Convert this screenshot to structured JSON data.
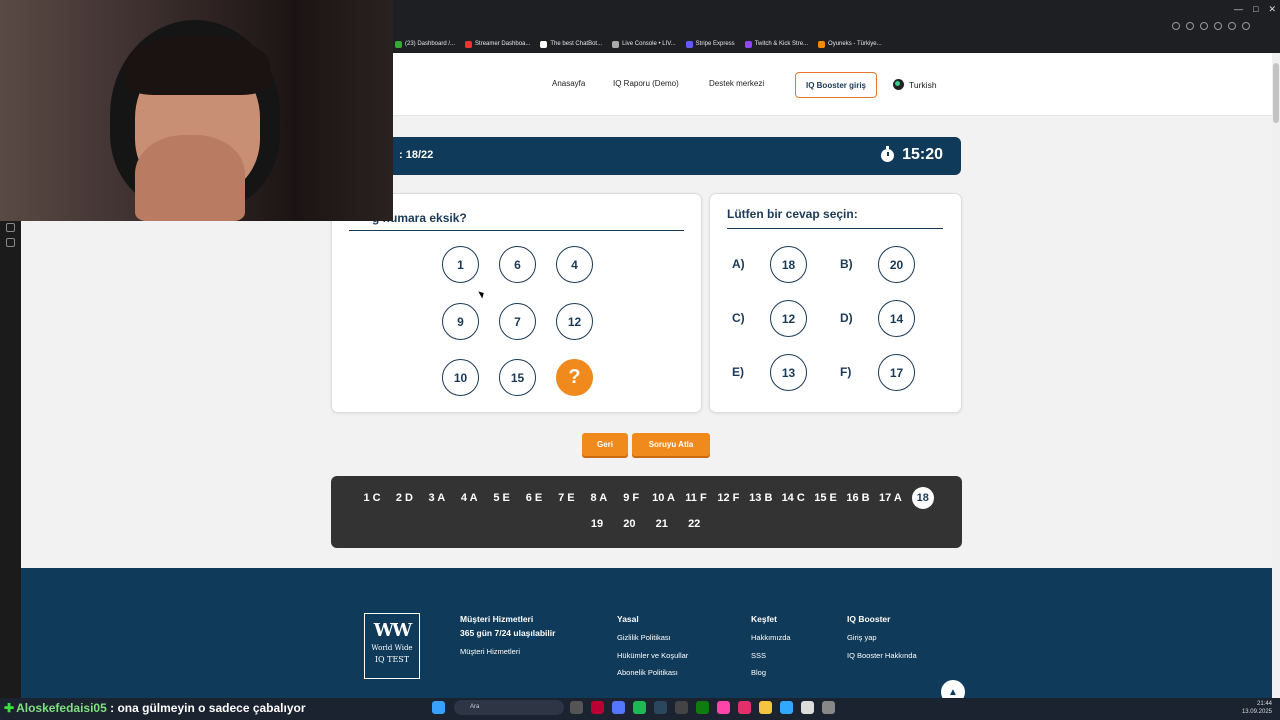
{
  "browser": {
    "bookmarks": [
      {
        "label": "(23) Dashboard /...",
        "color": "#3a3"
      },
      {
        "label": "Streamer Dashboa...",
        "color": "#e33"
      },
      {
        "label": "The best ChatBot...",
        "color": "#fff"
      },
      {
        "label": "Live Console • LIV...",
        "color": "#aaa"
      },
      {
        "label": "Stripe Express",
        "color": "#635bff"
      },
      {
        "label": "Twitch & Kick Stre...",
        "color": "#9146ff"
      },
      {
        "label": "Oyuneks - Türkiye...",
        "color": "#f80"
      }
    ]
  },
  "nav": {
    "home": "Anasayfa",
    "report": "IQ Raporu (Demo)",
    "support": "Destek merkezi",
    "booster_login": "IQ Booster giriş",
    "language": "Turkish"
  },
  "question_bar": {
    "progress": ": 18/22",
    "timer": "15:20"
  },
  "question_card": {
    "title": "g numara eksik?",
    "grid": [
      "1",
      "6",
      "4",
      "9",
      "7",
      "12",
      "10",
      "15",
      "?"
    ]
  },
  "answer_card": {
    "title": "Lütfen bir cevap seçin:",
    "options": [
      {
        "letter": "A)",
        "value": "18"
      },
      {
        "letter": "B)",
        "value": "20"
      },
      {
        "letter": "C)",
        "value": "12"
      },
      {
        "letter": "D)",
        "value": "14"
      },
      {
        "letter": "E)",
        "value": "13"
      },
      {
        "letter": "F)",
        "value": "17"
      }
    ]
  },
  "buttons": {
    "back": "Geri",
    "skip": "Soruyu Atla"
  },
  "question_nav": {
    "row1": [
      "1 C",
      "2 D",
      "3 A",
      "4 A",
      "5 E",
      "6 E",
      "7 E",
      "8 A",
      "9 F",
      "10 A",
      "11 F",
      "12 F",
      "13 B",
      "14 C",
      "15 E",
      "16 B",
      "17 A",
      "18"
    ],
    "row2": [
      "19",
      "20",
      "21",
      "22"
    ],
    "current": "18"
  },
  "footer": {
    "logo_mark": "WW",
    "logo_line1": "World Wide",
    "logo_line2": "IQ TEST",
    "customer_head": "Müşteri Hizmetleri",
    "customer_sub": "365 gün 7/24 ulaşılabilir",
    "customer_link": "Müşteri Hizmetleri",
    "legal_head": "Yasal",
    "legal_links": [
      "Gizlilik Politikası",
      "Hükümler ve Koşullar",
      "Abonelik Politikası"
    ],
    "discover_head": "Keşfet",
    "discover_links": [
      "Hakkımızda",
      "SSS",
      "Blog"
    ],
    "booster_head": "IQ Booster",
    "booster_links": [
      "Giriş yap",
      "IQ Booster Hakkında"
    ]
  },
  "stream_overlay": {
    "chat_user": "Aloskefedaisi05",
    "chat_text": " : ona gülmeyin o sadece çabalıyor"
  },
  "taskbar": {
    "search_placeholder": "Ara",
    "time": "21:44",
    "date": "13.09.2025"
  }
}
